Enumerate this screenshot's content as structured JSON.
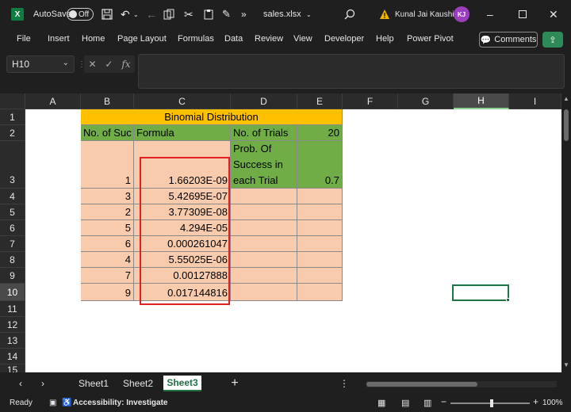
{
  "titlebar": {
    "app_icon": "excel-icon",
    "autosave_label": "AutoSave",
    "autosave_state": "Off",
    "filename": "sales.xlsx",
    "user_name": "Kunal Jai Kaushik",
    "user_initials": "KJ"
  },
  "menu": {
    "items": [
      "File",
      "Insert",
      "Home",
      "Page Layout",
      "Formulas",
      "Data",
      "Review",
      "View",
      "Developer",
      "Help",
      "Power Pivot"
    ],
    "comments_label": "Comments"
  },
  "formula_bar": {
    "name_box": "H10",
    "fx_label": "fx",
    "content": ""
  },
  "grid": {
    "columns": [
      "A",
      "B",
      "C",
      "D",
      "E",
      "F",
      "G",
      "H",
      "I"
    ],
    "rows": [
      "1",
      "2",
      "3",
      "4",
      "5",
      "6",
      "7",
      "8",
      "9",
      "10",
      "11",
      "12",
      "13",
      "14",
      "15"
    ],
    "selected_column": "H",
    "selected_row": "10",
    "title": "Binomial Distribution",
    "b2": "No. of Suc",
    "c2": "Formula",
    "d2": "No. of Trials",
    "e2": "20",
    "d3": "Prob. Of Success in each Trial",
    "e3": "0.7",
    "b_values": [
      "1",
      "3",
      "2",
      "5",
      "6",
      "4",
      "7",
      "9"
    ],
    "c_values": [
      "1.66203E-09",
      "5.42695E-07",
      "3.77309E-08",
      "4.294E-05",
      "0.000261047",
      "5.55025E-06",
      "0.00127888",
      "0.017144816"
    ]
  },
  "sheets": {
    "tabs": [
      "Sheet1",
      "Sheet2",
      "Sheet3"
    ],
    "active": "Sheet3"
  },
  "status": {
    "ready": "Ready",
    "accessibility": "Accessibility: Investigate",
    "zoom": "100%"
  },
  "colors": {
    "title_fill": "#ffc000",
    "header_fill": "#70ad47",
    "data_fill": "#f8cbad",
    "highlight_border": "#e02020",
    "excel_green": "#217346"
  }
}
